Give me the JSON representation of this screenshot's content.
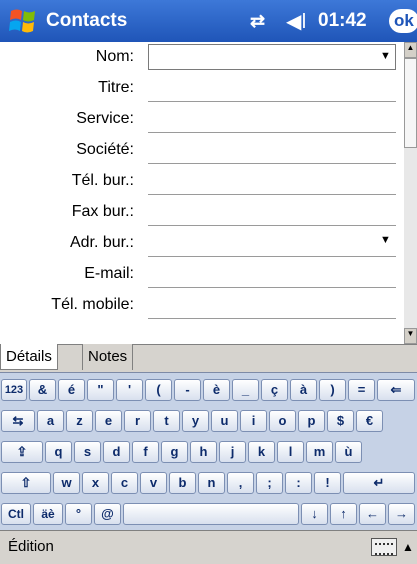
{
  "titlebar": {
    "title": "Contacts",
    "time": "01:42",
    "ok": "ok",
    "sync_glyph": "⇄",
    "volume_glyph": "◀ǀ"
  },
  "form": {
    "fields": [
      {
        "label": "Nom:",
        "value": ""
      },
      {
        "label": "Titre:",
        "value": ""
      },
      {
        "label": "Service:",
        "value": ""
      },
      {
        "label": "Société:",
        "value": ""
      },
      {
        "label": "Tél. bur.:",
        "value": ""
      },
      {
        "label": "Fax bur.:",
        "value": ""
      },
      {
        "label": "Adr. bur.:",
        "value": ""
      },
      {
        "label": "E-mail:",
        "value": ""
      },
      {
        "label": "Tél. mobile:",
        "value": ""
      }
    ]
  },
  "tabs": {
    "details": "Détails",
    "notes": "Notes"
  },
  "keyboard": {
    "row1": [
      "123",
      "&",
      "é",
      "\"",
      "'",
      "(",
      "-",
      "è",
      "_",
      "ç",
      "à",
      ")",
      "=",
      "⇐"
    ],
    "row2": [
      "⇆",
      "a",
      "z",
      "e",
      "r",
      "t",
      "y",
      "u",
      "i",
      "o",
      "p",
      "$",
      "€"
    ],
    "row3": [
      "⇪",
      "q",
      "s",
      "d",
      "f",
      "g",
      "h",
      "j",
      "k",
      "l",
      "m",
      "ù"
    ],
    "row4": [
      "⇧",
      "w",
      "x",
      "c",
      "v",
      "b",
      "n",
      ",",
      ";",
      ":",
      "!",
      "↵"
    ],
    "row5": [
      "Ctl",
      "äè",
      "°",
      "@",
      "",
      "↓",
      "↑",
      "←",
      "→"
    ]
  },
  "bottombar": {
    "menu": "Édition"
  }
}
